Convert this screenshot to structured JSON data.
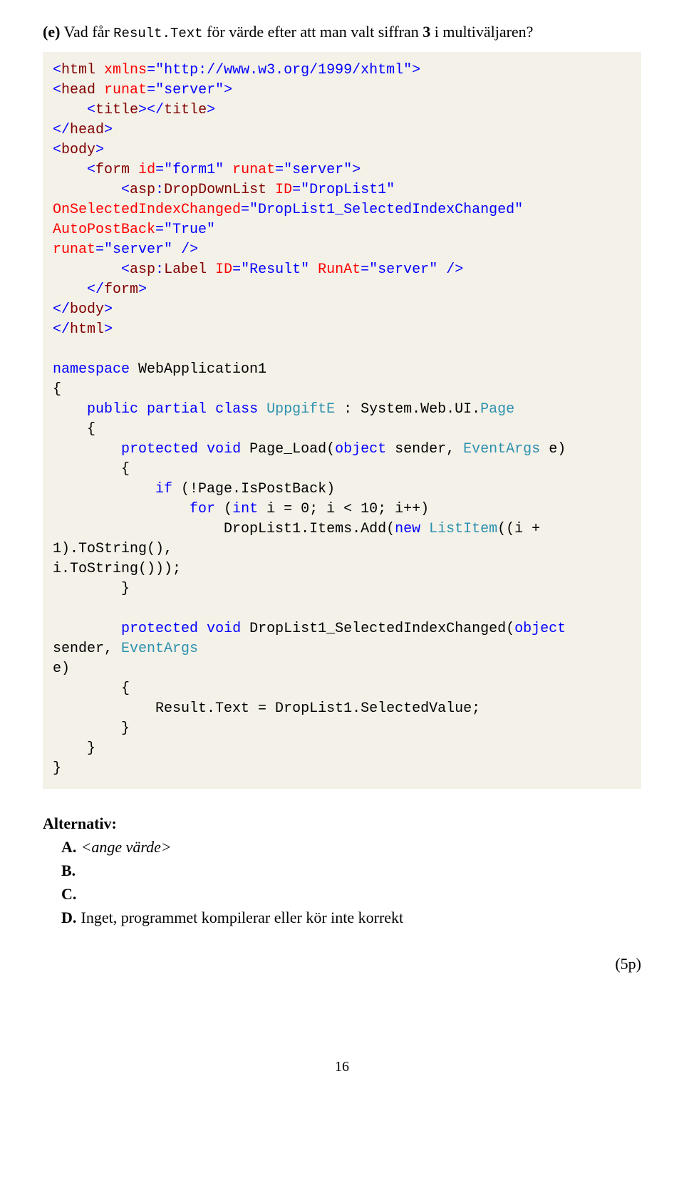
{
  "question": {
    "label": "(e)",
    "pre_text1": " Vad får ",
    "code_inline": "Result.Text",
    "pre_text2": " för värde efter att man valt siffran ",
    "bold_num": "3",
    "post_text": " i multiväljaren?"
  },
  "code": {
    "l0_p1": "<",
    "l0_tag": "html",
    "l0_sp": " ",
    "l0_attr": "xmlns",
    "l0_eq": "=\"http://www.w3.org/1999/xhtml\"",
    "l0_close": ">",
    "l1_p1": "<",
    "l1_tag": "head",
    "l1_sp": " ",
    "l1_attr": "runat",
    "l1_eq": "=\"server\"",
    "l1_close": ">",
    "l2a": "    <",
    "l2tag": "title",
    "l2b": "></",
    "l2c": "title",
    "l2d": ">",
    "l3a": "</",
    "l3tag": "head",
    "l3b": ">",
    "l4a": "<",
    "l4tag": "body",
    "l4b": ">",
    "l5a": "    <",
    "l5tag": "form",
    "l5sp": " ",
    "l5attr1": "id",
    "l5v1": "=\"form1\"",
    "l5sp2": " ",
    "l5attr2": "runat",
    "l5v2": "=\"server\"",
    "l5end": ">",
    "l6a": "        <",
    "l6tag": "asp",
    "l6colon": ":",
    "l6tag2": "DropDownList",
    "l6sp": " ",
    "l6attr1": "ID",
    "l6v1": "=\"DropList1\"",
    "l7attr1": "OnSelectedIndexChanged",
    "l7v1": "=\"DropList1_SelectedIndexChanged\"",
    "l7sp": " ",
    "l7attr2": "AutoPostBack",
    "l7v2": "=\"True\"",
    "l8attr": "runat",
    "l8v": "=\"server\"",
    "l8sp": " ",
    "l8end": "/>",
    "l9a": "        <",
    "l9tag": "asp",
    "l9colon": ":",
    "l9tag2": "Label",
    "l9sp": " ",
    "l9attr1": "ID",
    "l9v1": "=\"Result\"",
    "l9sp2": " ",
    "l9attr2": "RunAt",
    "l9v2": "=\"server\"",
    "l9sp3": " ",
    "l9end": "/>",
    "l10a": "    </",
    "l10tag": "form",
    "l10b": ">",
    "l11a": "</",
    "l11tag": "body",
    "l11b": ">",
    "l12a": "</",
    "l12tag": "html",
    "l12b": ">",
    "cs1": "namespace",
    "cs1b": " WebApplication1",
    "cs2": "{",
    "cs3": "    ",
    "cs3a": "public",
    "cs3sp": " ",
    "cs3b": "partial",
    "cs3sp2": " ",
    "cs3c": "class",
    "cs3sp3": " ",
    "cs3d": "UppgiftE",
    "cs3e": " : System.Web.UI.",
    "cs3f": "Page",
    "cs4": "    {",
    "cs5": "        ",
    "cs5a": "protected",
    "cs5sp": " ",
    "cs5b": "void",
    "cs5c": " Page_Load(",
    "cs5d": "object",
    "cs5e": " sender, ",
    "cs5f": "EventArgs",
    "cs5g": " e)",
    "cs6": "        {",
    "cs7": "            ",
    "cs7a": "if",
    "cs7b": " (!Page.IsPostBack)",
    "cs8": "                ",
    "cs8a": "for",
    "cs8b": " (",
    "cs8c": "int",
    "cs8d": " i = 0; i < 10; i++)",
    "cs9": "                    DropList1.Items.Add(",
    "cs9a": "new",
    "cs9sp": " ",
    "cs9b": "ListItem",
    "cs9c": "((i + 1).ToString(),",
    "cs10": "i.ToString()));",
    "cs11": "        }",
    "cs12": "        ",
    "cs12a": "protected",
    "cs12sp": " ",
    "cs12b": "void",
    "cs12c": " DropList1_SelectedIndexChanged(",
    "cs12d": "object",
    "cs12e": " sender, ",
    "cs12f": "EventArgs",
    "cs13": "e)",
    "cs14": "        {",
    "cs15": "            Result.Text = DropList1.SelectedValue;",
    "cs16": "        }",
    "cs17": "    }",
    "cs18": "}"
  },
  "alternatives": {
    "heading": "Alternativ:",
    "a_letter": "A.",
    "a_text": " <ange värde>",
    "b_letter": "B.",
    "c_letter": "C.",
    "d_letter": "D.",
    "d_text": " Inget, programmet kompilerar eller kör inte korrekt"
  },
  "points": "(5p)",
  "pagenum": "16"
}
